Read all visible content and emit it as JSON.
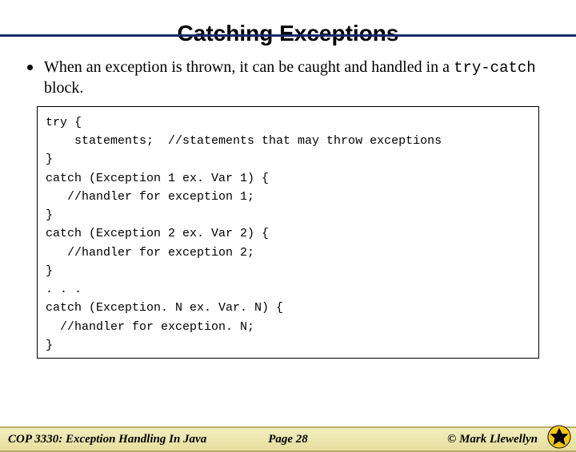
{
  "title": "Catching Exceptions",
  "bullet": {
    "pre": "When an exception is thrown, it can be caught and handled in a ",
    "code": "try-catch",
    "post": " block."
  },
  "code_lines": [
    "try {",
    "    statements;  //statements that may throw exceptions",
    "}",
    "catch (Exception 1 ex. Var 1) {",
    "   //handler for exception 1;",
    "}",
    "catch (Exception 2 ex. Var 2) {",
    "   //handler for exception 2;",
    "}",
    ". . .",
    "catch (Exception. N ex. Var. N) {",
    "  //handler for exception. N;",
    "}"
  ],
  "footer": {
    "left": "COP 3330:  Exception Handling In Java",
    "center": "Page 28",
    "right": "© Mark Llewellyn"
  }
}
